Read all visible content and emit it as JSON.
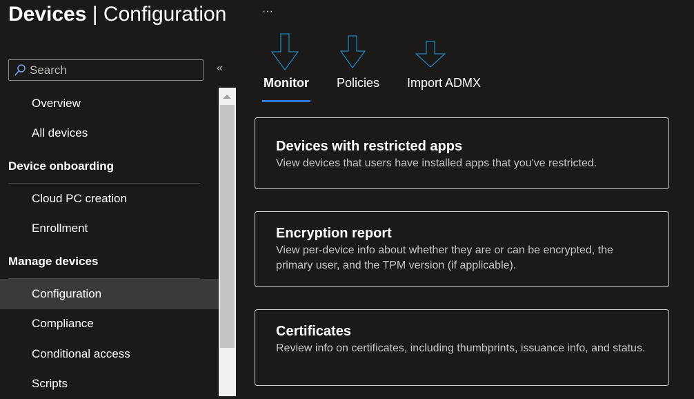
{
  "header": {
    "title_bold": "Devices",
    "separator": " | ",
    "title_rest": "Configuration",
    "more": "···"
  },
  "sidebar": {
    "search_placeholder": "Search",
    "collapse": "«",
    "items": [
      {
        "type": "item",
        "label": "Overview"
      },
      {
        "type": "item",
        "label": "All devices"
      },
      {
        "type": "group",
        "label": "Device onboarding"
      },
      {
        "type": "item",
        "label": "Cloud PC creation"
      },
      {
        "type": "item",
        "label": "Enrollment"
      },
      {
        "type": "group",
        "label": "Manage devices"
      },
      {
        "type": "item",
        "label": "Configuration",
        "selected": true
      },
      {
        "type": "item",
        "label": "Compliance"
      },
      {
        "type": "item",
        "label": "Conditional access"
      },
      {
        "type": "item",
        "label": "Scripts"
      }
    ]
  },
  "tabs": [
    {
      "label": "Monitor",
      "active": true
    },
    {
      "label": "Policies"
    },
    {
      "label": "Import ADMX"
    }
  ],
  "cards": [
    {
      "title": "Devices with restricted apps",
      "desc": "View devices that users have installed apps that you've restricted."
    },
    {
      "title": "Encryption report",
      "desc": "View per-device info about whether they are or can be encrypted, the primary user, and the TPM version (if applicable)."
    },
    {
      "title": "Certificates",
      "desc": "Review info on certificates, including thumbprints, issuance info, and status."
    }
  ],
  "colors": {
    "accent": "#2f7ad0",
    "arrow": "#1aa3e8"
  }
}
